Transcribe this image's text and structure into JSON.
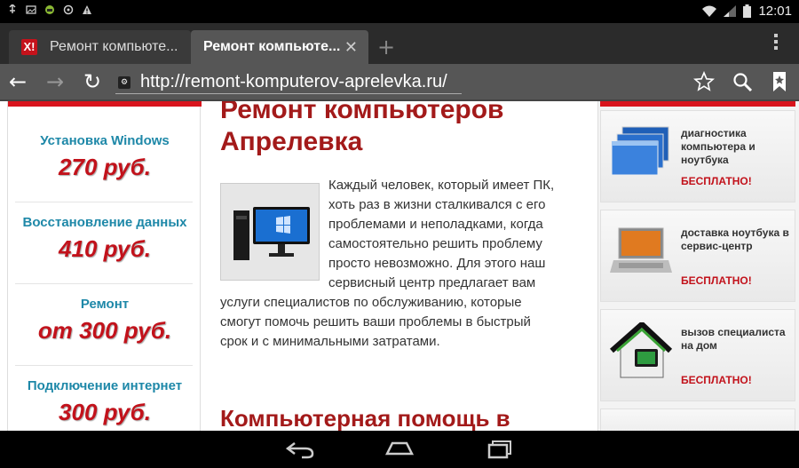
{
  "status_bar": {
    "time": "12:01",
    "left_icons": [
      "usb-icon",
      "image-icon",
      "android-debug-icon",
      "sync-icon",
      "warning-icon"
    ],
    "right_icons": [
      "wifi-icon",
      "signal-icon",
      "battery-icon"
    ]
  },
  "tabs": [
    {
      "title": "Ремонт компьюте...",
      "favicon": "Х!",
      "active": false
    },
    {
      "title": "Ремонт компьюте...",
      "active": true,
      "close": "✕"
    }
  ],
  "toolbar": {
    "url": "http://remont-komputerov-aprelevka.ru/",
    "back_icon": "←",
    "forward_icon": "→",
    "reload_icon": "↻",
    "new_tab": "+"
  },
  "left_column": {
    "items": [
      {
        "title": "Установка Windows",
        "price": "270 руб."
      },
      {
        "title": "Восстановление данных",
        "price": "410 руб."
      },
      {
        "title": "Ремонт",
        "price": "от 300 руб."
      },
      {
        "title": "Подключение интернет",
        "price": "300 руб."
      }
    ]
  },
  "main": {
    "heading": "Ремонт компьютеров Апрелевка",
    "paragraph": "Каждый человек, который имеет ПК, хоть раз в жизни сталкивался с его проблемами и неполадками, когда самостоятельно решить проблему просто невозможно. Для этого наш сервисный центр предлагает вам услуги специалистов по обслуживанию, которые смогут помочь решить ваши проблемы в быстрый срок и с минимальными затратами.",
    "subheading": "Компьютерная помощь в"
  },
  "right_column": {
    "services": [
      {
        "title": "диагностика компьютера и ноутбука",
        "free": "БЕСПЛАТНО!",
        "icon": "windows-screens-icon"
      },
      {
        "title": "доставка ноутбука в сервис-центр",
        "free": "БЕСПЛАТНО!",
        "icon": "laptop-icon"
      },
      {
        "title": "вызов специалиста на дом",
        "free": "БЕСПЛАТНО!",
        "icon": "house-icon"
      }
    ]
  },
  "colors": {
    "accent_red": "#c2121b",
    "heading_red": "#a31a1a",
    "blue_title": "#1e88a8"
  }
}
